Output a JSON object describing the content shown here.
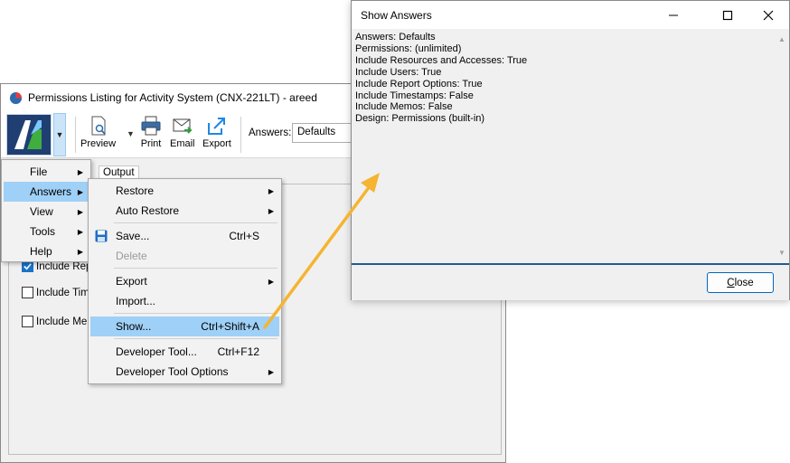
{
  "main_window": {
    "title": "Permissions Listing for Activity System (CNX-221LT) - areed",
    "ribbon": {
      "preview_label": "Preview",
      "print_label": "Print",
      "email_label": "Email",
      "export_label": "Export",
      "answers_label": "Answers:",
      "answers_value": "Defaults"
    },
    "output_tab_label": "Output",
    "options": [
      {
        "label": "Include Repo",
        "checked": true
      },
      {
        "label": "Include Time",
        "checked": false
      },
      {
        "label": "Include Mem",
        "checked": false
      }
    ]
  },
  "primary_menu": {
    "items": [
      {
        "label": "File",
        "has_submenu": true
      },
      {
        "label": "Answers",
        "has_submenu": true
      },
      {
        "label": "View",
        "has_submenu": true
      },
      {
        "label": "Tools",
        "has_submenu": true
      },
      {
        "label": "Help",
        "has_submenu": true
      }
    ]
  },
  "answers_menu": {
    "items": [
      {
        "label": "Restore",
        "shortcut": "",
        "has_submenu": true
      },
      {
        "label": "Auto Restore",
        "shortcut": "",
        "has_submenu": true
      },
      {
        "label": "Save...",
        "shortcut": "Ctrl+S",
        "icon": "save-icon"
      },
      {
        "label": "Delete",
        "shortcut": "",
        "disabled": true
      },
      {
        "label": "Export",
        "shortcut": "",
        "has_submenu": true
      },
      {
        "label": "Import...",
        "shortcut": ""
      },
      {
        "label": "Show...",
        "shortcut": "Ctrl+Shift+A"
      },
      {
        "label": "Developer Tool...",
        "shortcut": "Ctrl+F12"
      },
      {
        "label": "Developer Tool Options",
        "shortcut": "",
        "has_submenu": true
      }
    ]
  },
  "show_answers_dialog": {
    "title": "Show Answers",
    "lines": [
      "Answers: Defaults",
      "Permissions: (unlimited)",
      "Include Resources and Accesses: True",
      "Include Users: True",
      "Include Report Options: True",
      "Include Timestamps: False",
      "Include Memos: False",
      "Design: Permissions (built-in)"
    ],
    "close_prefix": "",
    "close_underlined": "C",
    "close_rest": "lose"
  },
  "colors": {
    "accent": "#0067c0",
    "menu_highlight": "#cce8ff",
    "menu_highlight_strong": "#9fd0f7",
    "callout_arrow": "#f5b431",
    "dialog_rule": "#1e5c92"
  }
}
